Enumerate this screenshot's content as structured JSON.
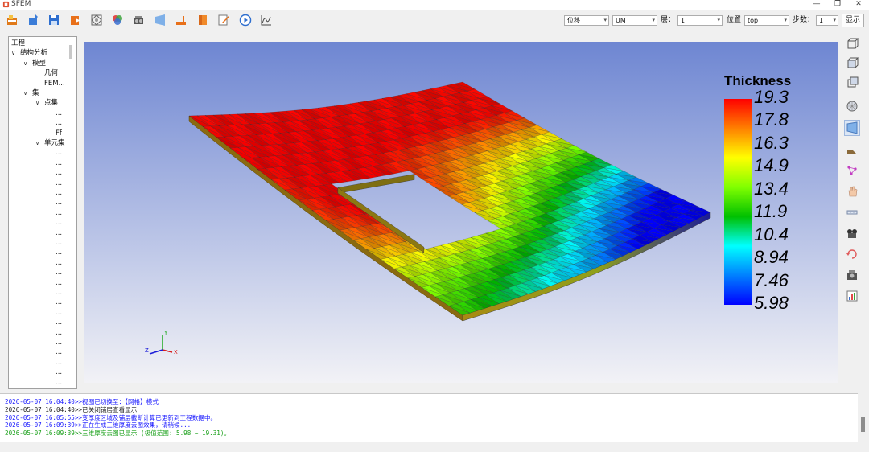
{
  "window": {
    "title": "SFEM"
  },
  "toolbar": {
    "icons": [
      "open-project-icon",
      "import-icon",
      "save-icon",
      "export-icon",
      "mesh-icon",
      "material-icon",
      "layup-icon",
      "section-icon",
      "boundary-icon",
      "thickness-icon",
      "edit-icon",
      "run-icon",
      "result-plot-icon"
    ],
    "controls": {
      "result_type": "位移",
      "component": "UM",
      "layer_label": "层：",
      "layer_value": "1",
      "position_label": "位置",
      "position_value": "top",
      "step_label": "步数：",
      "step_value": "1",
      "show_label": "显示"
    }
  },
  "tree": {
    "root": "工程",
    "analysis": "结构分析",
    "model": "模型",
    "geometry": "几何",
    "fem": "FEM...",
    "sets": "集",
    "node_sets": "点集",
    "node_set_items": [
      "...",
      "...",
      "Ff"
    ],
    "element_sets": "单元集",
    "element_set_items": [
      "...",
      "...",
      "...",
      "...",
      "...",
      "...",
      "...",
      "...",
      "...",
      "...",
      "...",
      "...",
      "...",
      "...",
      "...",
      "...",
      "...",
      "...",
      "...",
      "...",
      "...",
      "...",
      "...",
      "..."
    ]
  },
  "viewport": {
    "legend": {
      "title": "Thickness",
      "ticks": [
        "19.3",
        "17.8",
        "16.3",
        "14.9",
        "13.4",
        "11.9",
        "10.4",
        "8.94",
        "7.46",
        "5.98"
      ],
      "colors": [
        "#ff0000",
        "#ff8000",
        "#ffff00",
        "#80ff00",
        "#00c000",
        "#00ffff",
        "#0080ff",
        "#0000ff"
      ]
    },
    "axes": {
      "y": "Y",
      "x": "X",
      "z": "Z"
    },
    "background_top": "#6e86d2",
    "background_bottom": "#f2f2f6"
  },
  "side_tools": [
    "view-iso-icon",
    "view-front-icon",
    "view-back-icon",
    "view-mesh-icon",
    "view-shaded-icon",
    "section-cut-icon",
    "node-pick-icon",
    "hand-pan-icon",
    "ruler-icon",
    "camera-icon",
    "rotate-icon",
    "screenshot-icon",
    "chart-icon"
  ],
  "log": [
    {
      "time": "2026-05-07 16:04:40>>",
      "text": "视图已切换至：【网格】模式",
      "color": "#1a1aff"
    },
    {
      "time": "2026-05-07 16:04:40>>",
      "text": "已关闭铺层查看显示",
      "color": "#222222"
    },
    {
      "time": "2026-05-07 16:05:55>>",
      "text": "变厚度区域及铺层截断计算已更新到工程数据中。",
      "color": "#1a1aff"
    },
    {
      "time": "2026-05-07 16:09:39>>",
      "text": "正在生成三维厚度云图效果，请稍候...",
      "color": "#1a1aff"
    },
    {
      "time": "2026-05-07 16:09:39>>",
      "text": "三维厚度云图已显示 (极值范围: 5.98 ~ 19.31)。",
      "color": "#1aa01a"
    }
  ]
}
